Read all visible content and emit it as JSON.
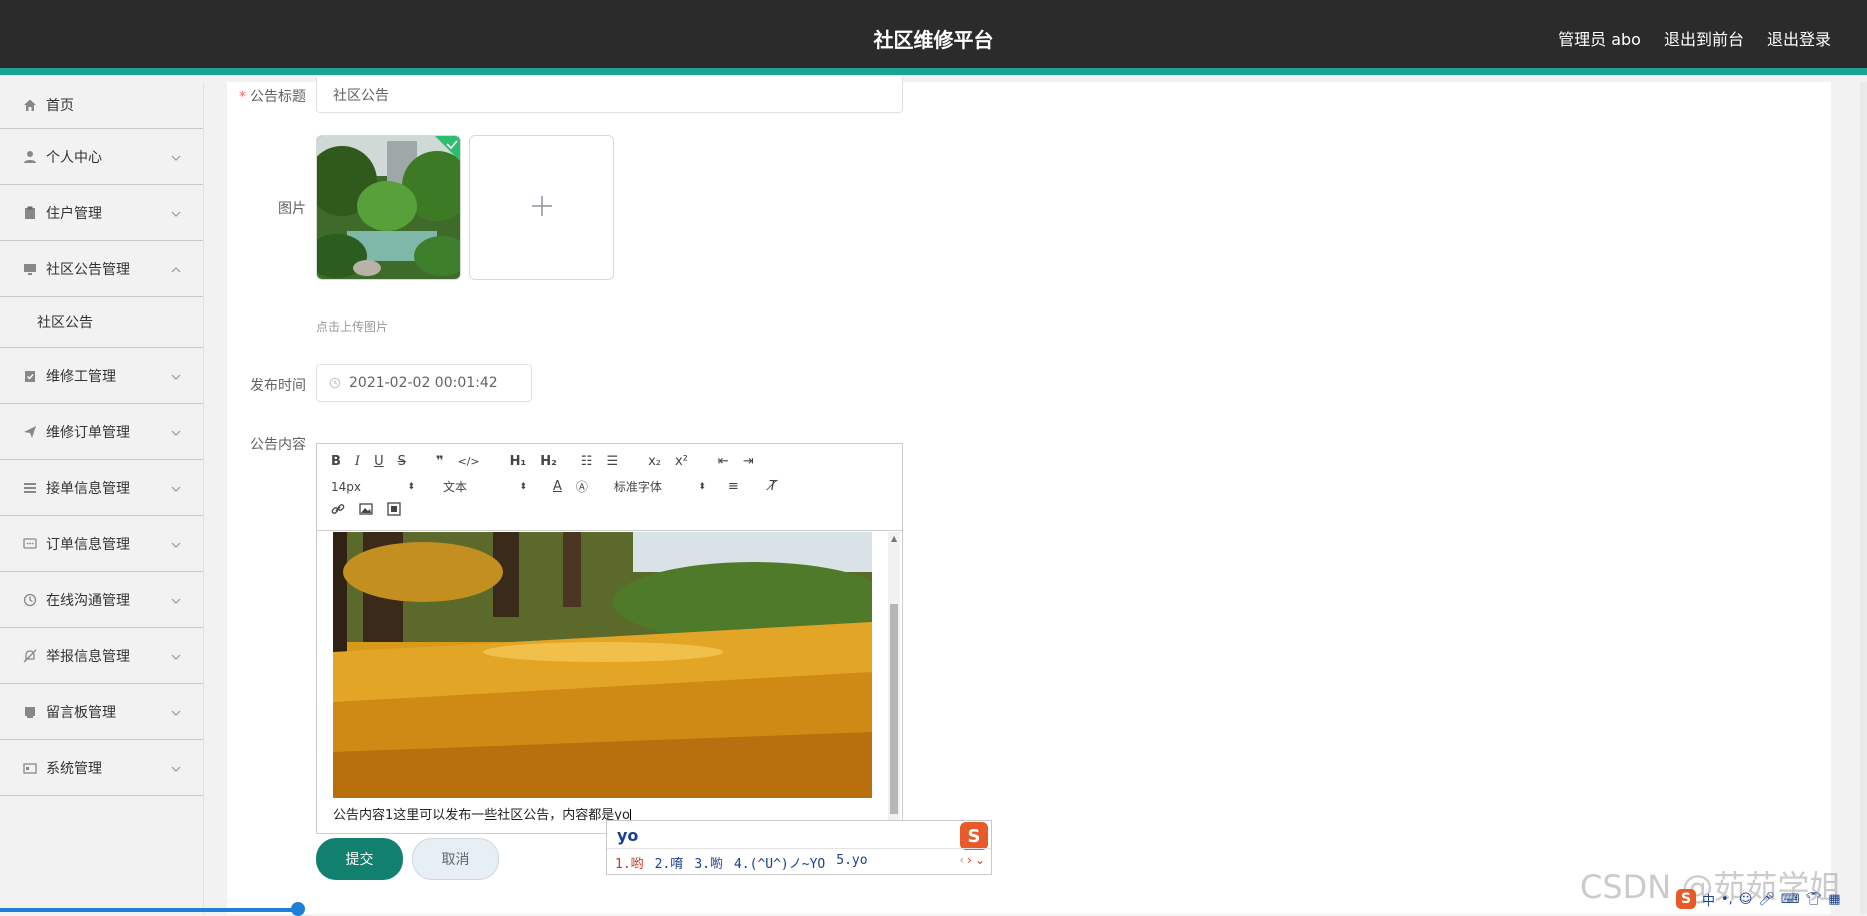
{
  "header": {
    "title": "社区维修平台",
    "links": [
      "管理员 abo",
      "退出到前台",
      "退出登录"
    ]
  },
  "sidebar": {
    "items": [
      {
        "label": "首页",
        "icon": "home-icon",
        "expand": false
      },
      {
        "label": "个人中心",
        "icon": "user-icon",
        "expand": true
      },
      {
        "label": "住户管理",
        "icon": "clipboard-icon",
        "expand": true
      },
      {
        "label": "社区公告管理",
        "icon": "monitor-icon",
        "expand": true,
        "open": true
      },
      {
        "label": "维修工管理",
        "icon": "checklist-icon",
        "expand": true
      },
      {
        "label": "维修订单管理",
        "icon": "send-icon",
        "expand": true
      },
      {
        "label": "接单信息管理",
        "icon": "menu-icon",
        "expand": true
      },
      {
        "label": "订单信息管理",
        "icon": "chat-icon",
        "expand": true
      },
      {
        "label": "在线沟通管理",
        "icon": "clock-icon",
        "expand": true
      },
      {
        "label": "举报信息管理",
        "icon": "bell-off-icon",
        "expand": true
      },
      {
        "label": "留言板管理",
        "icon": "board-icon",
        "expand": true
      },
      {
        "label": "系统管理",
        "icon": "settings-card-icon",
        "expand": true
      }
    ],
    "submenu": "社区公告"
  },
  "form": {
    "title_label": "公告标题",
    "title_value": "社区公告",
    "image_label": "图片",
    "upload_hint": "点击上传图片",
    "date_label": "发布时间",
    "date_value": "2021-02-02 00:01:42",
    "content_label": "公告内容",
    "content_text": "公告内容1这里可以发布一些社区公告，内容都是yo",
    "submit": "提交",
    "cancel": "取消"
  },
  "editor": {
    "font_size": "14px",
    "block_type": "文本",
    "font_family": "标准字体"
  },
  "ime": {
    "input": "yo",
    "candidates": [
      "1.哟",
      "2.唷",
      "3.喲",
      "4.(^U^)ノ~YO",
      "5.yo"
    ]
  },
  "watermark": "CSDN @茹茹学姐",
  "colors": {
    "accent": "#1aa391",
    "primary_button": "#12806f",
    "topbar": "#2b2b2b"
  }
}
